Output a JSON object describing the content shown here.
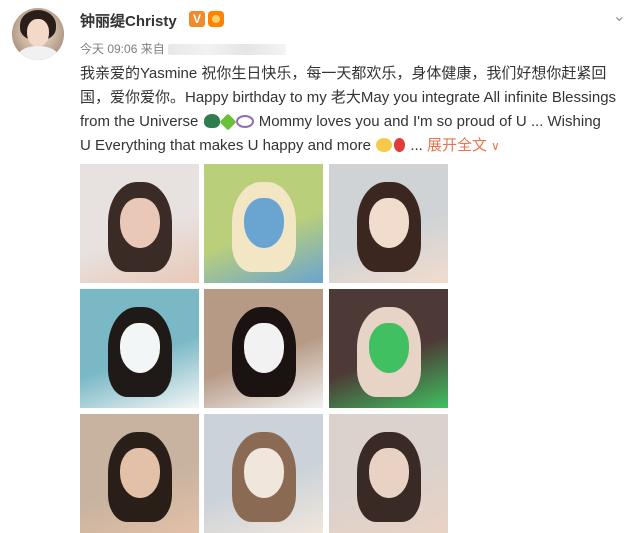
{
  "header": {
    "username": "钟丽缇Christy",
    "verified_badge": "V",
    "menu_icon": "chevron-down-icon"
  },
  "meta": {
    "time": "今天 09:06",
    "source_prefix": "来自"
  },
  "post": {
    "line1": "我亲爱的Yasmine 祝你生日快乐，每一天都欢乐，身体健康，我们好想你赶紧回",
    "line2": "国，爱你爱你。Happy birthday to my 老大May you integrate All infinite Blessings",
    "line3_before": "from the Universe",
    "line3_after": "Mommy loves you and I'm so proud of U ... Wishing",
    "line4": "U Everything that makes U happy and more",
    "ellipsis": "...",
    "expand_label": "展开全文",
    "expand_icon": "∨"
  },
  "photos": [
    {
      "id": "photo-1",
      "colors": [
        "#e7e2df",
        "#3b2b26",
        "#e9c8b8"
      ]
    },
    {
      "id": "photo-2",
      "colors": [
        "#b9cf7a",
        "#f3e6c5",
        "#6aa4d0"
      ]
    },
    {
      "id": "photo-3",
      "colors": [
        "#cfd3d6",
        "#3b2620",
        "#f1dccd"
      ]
    },
    {
      "id": "photo-4",
      "colors": [
        "#7ab8c6",
        "#1f1a17",
        "#f3f6f6"
      ]
    },
    {
      "id": "photo-5",
      "colors": [
        "#b79a86",
        "#1a1311",
        "#f2f2f2"
      ]
    },
    {
      "id": "photo-6",
      "colors": [
        "#4d3a36",
        "#e7d4c7",
        "#40c060"
      ]
    },
    {
      "id": "photo-7",
      "colors": [
        "#c7b39f",
        "#2a1e18",
        "#e3c0a8"
      ]
    },
    {
      "id": "photo-8",
      "colors": [
        "#cbd2d9",
        "#8a6a52",
        "#f0e6dc"
      ]
    },
    {
      "id": "photo-9",
      "colors": [
        "#dcd2cd",
        "#3a2a25",
        "#e9d2c4"
      ]
    }
  ]
}
